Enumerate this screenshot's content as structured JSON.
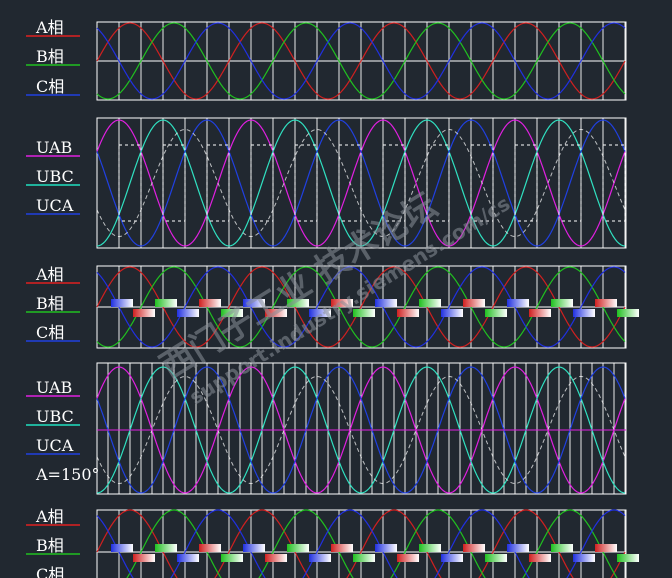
{
  "panels": [
    {
      "id": "phase-1",
      "labels": [
        "A相",
        "B相",
        "C相"
      ],
      "label_colors": [
        "#e02020",
        "#20c020",
        "#2040e0"
      ]
    },
    {
      "id": "line-1",
      "labels": [
        "UAB",
        "UBC",
        "UCA"
      ],
      "label_colors": [
        "#e020e0",
        "#20e0c0",
        "#2040e0"
      ]
    },
    {
      "id": "phase-2",
      "labels": [
        "A相",
        "B相",
        "C相"
      ],
      "label_colors": [
        "#e02020",
        "#20c020",
        "#2040e0"
      ]
    },
    {
      "id": "line-2",
      "labels": [
        "UAB",
        "UBC",
        "UCA"
      ],
      "label_colors": [
        "#e020e0",
        "#20e0c0",
        "#2040e0"
      ],
      "angle_label": "A=150°"
    },
    {
      "id": "phase-3",
      "labels": [
        "A相",
        "B相",
        "C相"
      ],
      "label_colors": [
        "#e02020",
        "#20c020",
        "#2040e0"
      ]
    }
  ],
  "watermark": {
    "line1": "西门子工业  技术论坛",
    "line2": "support.industry.siemens.com/cs"
  },
  "colors": {
    "background": "#212830",
    "grid": "#ffffff",
    "phase_a": "#d02020",
    "phase_b": "#20c020",
    "phase_c": "#2030e0",
    "uab": "#e020e0",
    "ubc": "#30e0c0",
    "uca": "#2040e0"
  }
}
